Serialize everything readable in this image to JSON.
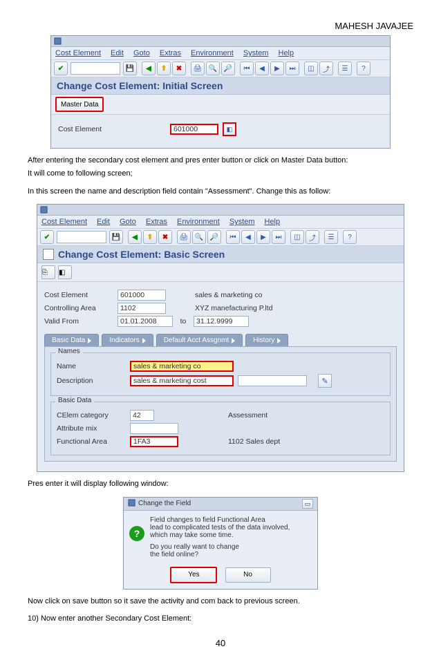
{
  "author": "MAHESH JAVAJEE",
  "page_number": "40",
  "menubar": {
    "m1": "Cost Element",
    "m2": "Edit",
    "m3": "Goto",
    "m4": "Extras",
    "m5": "Environment",
    "m6": "System",
    "m7": "Help"
  },
  "screen1": {
    "title": "Change Cost Element: Initial Screen",
    "master_data_btn": "Master Data",
    "cost_element_label": "Cost Element",
    "cost_element_value": "601000"
  },
  "prose1a": "After entering the secondary cost element and pres enter button or  click on Master Data button:",
  "prose1b": "It will come to following screen;",
  "prose2": "In this screen the name and description field contain \"Assessment\". Change this as follow:",
  "screen2": {
    "title": "Change Cost Element: Basic Screen",
    "cost_element_label": "Cost Element",
    "cost_element_value": "601000",
    "cost_element_text": "sales & marketing co",
    "co_area_label": "Controlling Area",
    "co_area_value": "1102",
    "co_area_text": "XYZ manefacturing P.ltd",
    "valid_from_label": "Valid From",
    "valid_from_value": "01.01.2008",
    "to_label": "to",
    "valid_to_value": "31.12.9999",
    "tabs": {
      "t1": "Basic Data",
      "t2": "Indicators",
      "t3": "Default Acct Assgnmt",
      "t4": "History"
    },
    "group_names": "Names",
    "name_label": "Name",
    "name_value": "sales & marketing co",
    "desc_label": "Description",
    "desc_value": "sales & marketing cost",
    "group_basic": "Basic Data",
    "cat_label": "CElem category",
    "cat_value": "42",
    "cat_text": "Assessment",
    "attr_label": "Attribute mix",
    "fa_label": "Functional Area",
    "fa_value": "1FA3",
    "fa_text": "1102 Sales dept"
  },
  "prose3": "Pres enter it will display following window:",
  "dialog": {
    "title": "Change the Field",
    "line1": "Field changes to field Functional Area",
    "line2": "lead to complicated tests of the data involved,",
    "line3": "which may take some time.",
    "line4": "Do you really want to change",
    "line5": "the field online?",
    "yes": "Yes",
    "no": "No"
  },
  "prose4": "Now click on save button so it save the activity and com back to previous screen.",
  "prose5": "10) Now enter another Secondary Cost Element:"
}
